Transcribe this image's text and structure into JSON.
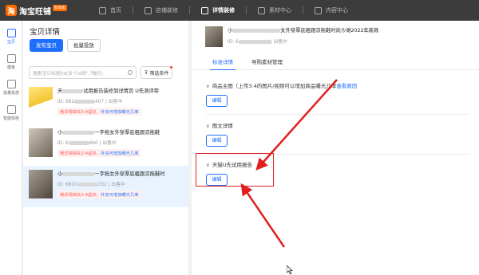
{
  "app": {
    "logo_text": "淘宝旺铺",
    "logo_badge": "智能版"
  },
  "nav": {
    "items": [
      {
        "label": "首页"
      },
      {
        "label": "店铺装修"
      },
      {
        "label": "详情装修"
      },
      {
        "label": "素材中心"
      },
      {
        "label": "内容中心"
      }
    ],
    "active_index": 2
  },
  "rail": {
    "items": [
      {
        "label": "宝贝"
      },
      {
        "label": "模板"
      },
      {
        "label": "批量投放"
      },
      {
        "label": "智能体检"
      }
    ]
  },
  "list_panel": {
    "title": "宝贝详情",
    "publish_button": "发布宝贝",
    "batch_button": "批量投放",
    "search_placeholder": "搜索宝贝标题/id(多个id用\",\"隔开)",
    "filter_button": "筛选条件",
    "items": [
      {
        "title_pre": "天",
        "title_post": "试用报告装修到详情页 U先测评审",
        "id_pre": "ID: 682",
        "id_post": "407 | 出售中",
        "tag": "微详情缺失3-4星好，",
        "tag_link": "补充可增加曝光几率"
      },
      {
        "title_pre": "小",
        "title_post": "一字拖女外穿厚底粗跟凉拖鞋",
        "id_pre": "ID: 6",
        "id_post": "460 | 出售中",
        "tag": "微详情缺失3-4星好，",
        "tag_link": "补充可增加曝光几率"
      },
      {
        "title_pre": "小",
        "title_post": "一字拖女外穿厚底粗跟凉拖鞋时",
        "id_pre": "ID: 6810",
        "id_post": "332 | 出售中",
        "tag": "微详情缺失3-4星好，",
        "tag_link": "补充可增加曝光几率"
      }
    ]
  },
  "detail": {
    "title_pre": "小",
    "title_post": "女外穿厚底粗跟凉拖鞋时尚沙滩2022年新款",
    "id_pre": "ID: 6",
    "id_post": "| 出售中",
    "tabs": [
      {
        "label": "标准详情"
      },
      {
        "label": "导购素材管理"
      }
    ],
    "sections": [
      {
        "title": "商品主图（上传3:4的图片/视频可以增加商品曝光几率",
        "link": "查看原因",
        "edit": "编辑"
      },
      {
        "title": "图文详情",
        "link": "",
        "edit": "编辑"
      },
      {
        "title": "天猫U先试用报告",
        "link": "",
        "edit": "编辑"
      }
    ]
  },
  "colors": {
    "accent": "#1f6fff",
    "topbar": "#3c3c3c",
    "annotation": "#e02020"
  }
}
